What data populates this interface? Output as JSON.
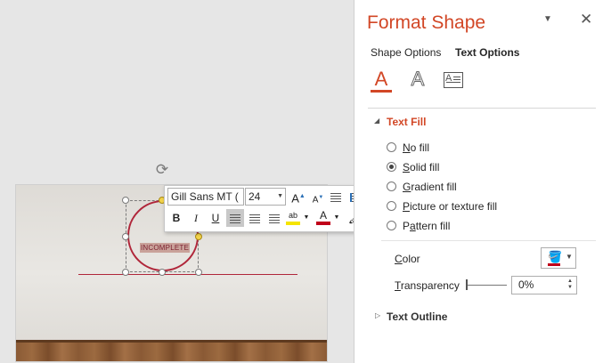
{
  "mini_toolbar": {
    "font_name": "Gill Sans MT (",
    "font_size": "24",
    "grow_font": "A",
    "shrink_font": "A",
    "bold": "B",
    "italic": "I",
    "underline": "U",
    "font_color_glyph": "A",
    "highlight_glyph": "ab"
  },
  "slide": {
    "shape_text": "INCOMPLETE",
    "colors": {
      "line": "#b0263a",
      "circle": "#b0263a"
    }
  },
  "pane": {
    "title": "Format Shape",
    "tabs": [
      "Shape Options",
      "Text Options"
    ],
    "active_tab": "Text Options",
    "icon_fill_glyph": "A",
    "icon_outline_glyph": "A",
    "icon_box_glyph": "A",
    "text_fill": {
      "label": "Text Fill",
      "options": [
        {
          "key": "N",
          "rest": "o fill",
          "selected": false
        },
        {
          "key": "S",
          "rest": "olid fill",
          "selected": true
        },
        {
          "key": "G",
          "rest": "radient fill",
          "selected": false
        },
        {
          "key": "P",
          "rest": "icture or texture fill",
          "selected": false
        },
        {
          "key": "P",
          "rest": "a",
          "rest2": "ttern fill",
          "selected": false
        }
      ]
    },
    "color_label_pre": "",
    "color_label_key": "C",
    "color_label_rest": "olor",
    "transparency_key": "T",
    "transparency_rest": "ransparency",
    "transparency_value": "0%",
    "text_outline_label": "Text Outline",
    "accent_color": "#d24726"
  }
}
